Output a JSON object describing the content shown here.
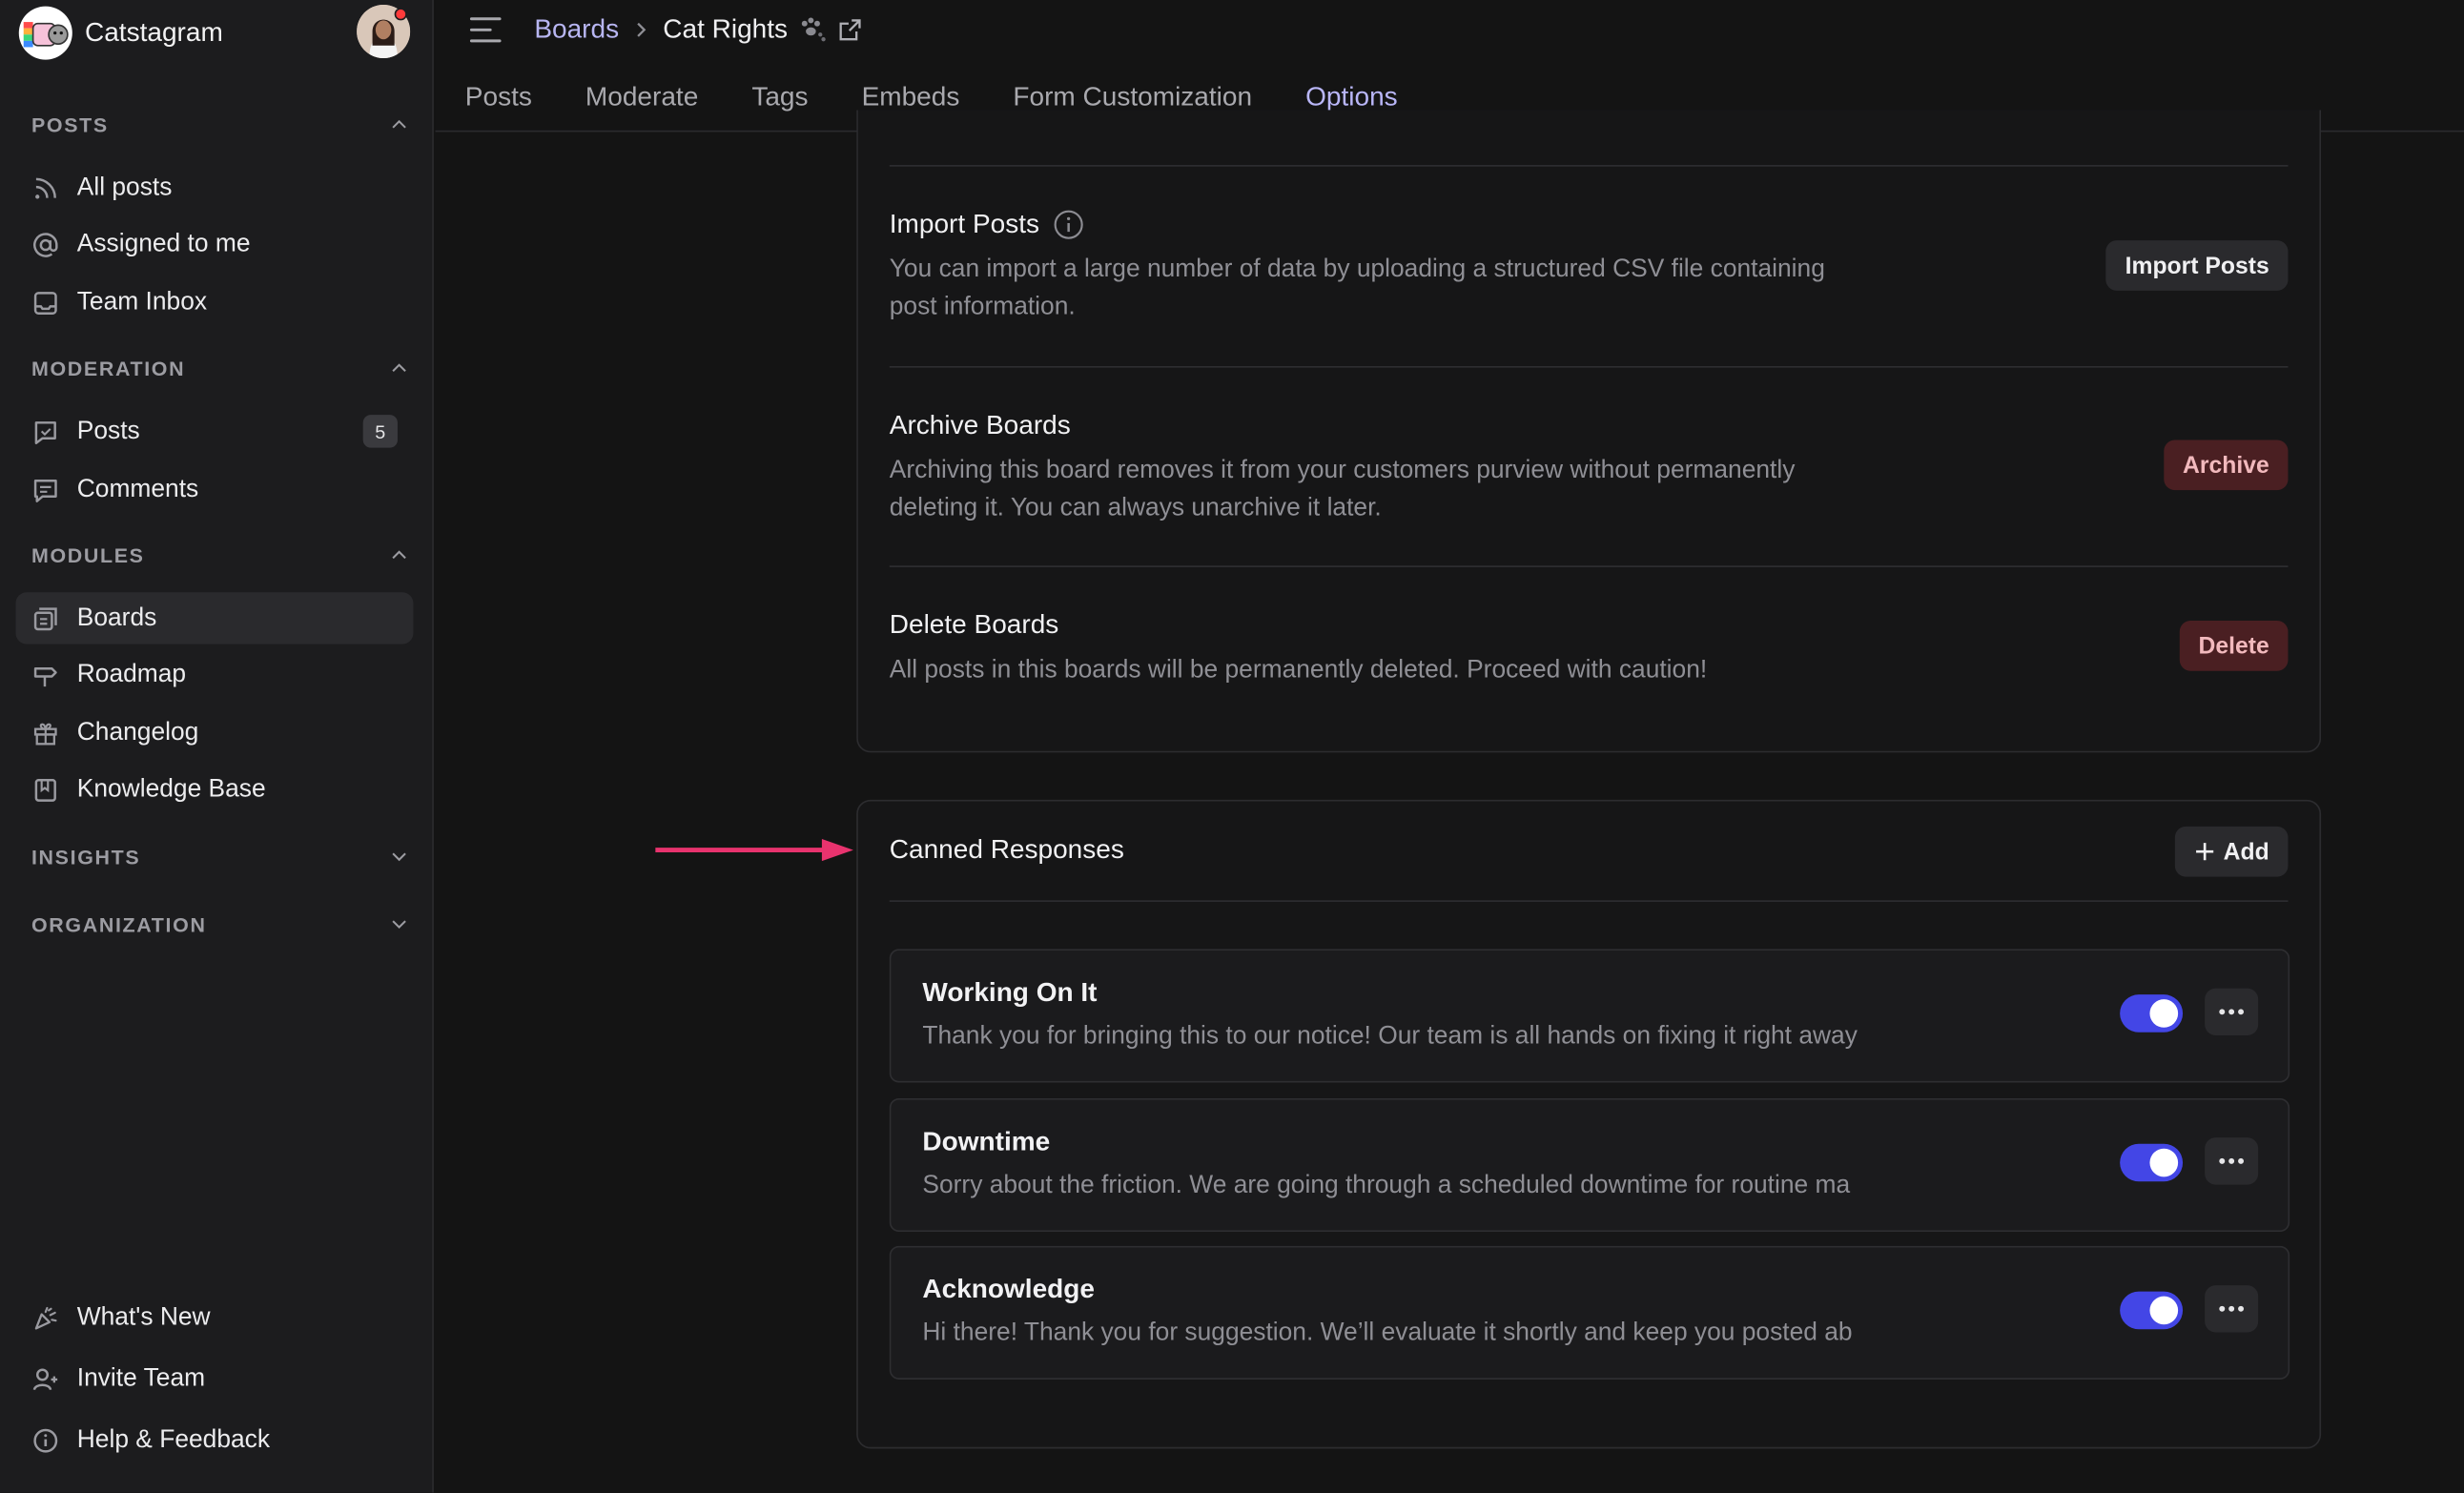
{
  "workspace": {
    "name": "Catstagram"
  },
  "sidebar": {
    "sections": [
      {
        "title": "POSTS",
        "items": [
          {
            "label": "All posts",
            "icon": "rss-icon"
          },
          {
            "label": "Assigned to me",
            "icon": "at-sign-icon"
          },
          {
            "label": "Team Inbox",
            "icon": "inbox-icon"
          }
        ]
      },
      {
        "title": "MODERATION",
        "items": [
          {
            "label": "Posts",
            "icon": "post-moderation-icon",
            "badge": "5"
          },
          {
            "label": "Comments",
            "icon": "comment-icon"
          }
        ]
      },
      {
        "title": "MODULES",
        "items": [
          {
            "label": "Boards",
            "icon": "boards-icon"
          },
          {
            "label": "Roadmap",
            "icon": "signpost-icon"
          },
          {
            "label": "Changelog",
            "icon": "gift-icon"
          },
          {
            "label": "Knowledge Base",
            "icon": "book-icon"
          }
        ]
      },
      {
        "title": "INSIGHTS",
        "items": []
      },
      {
        "title": "ORGANIZATION",
        "items": []
      }
    ],
    "footer": [
      {
        "label": "What's New",
        "icon": "party-popper-icon"
      },
      {
        "label": "Invite Team",
        "icon": "user-plus-icon"
      },
      {
        "label": "Help & Feedback",
        "icon": "info-circle-icon"
      }
    ]
  },
  "breadcrumb": {
    "parent": "Boards",
    "current": "Cat Rights"
  },
  "tabs": [
    "Posts",
    "Moderate",
    "Tags",
    "Embeds",
    "Form Customization",
    "Options"
  ],
  "active_tab": "Options",
  "options": [
    {
      "title": "Import Posts",
      "description": "You can import a large number of data by uploading a structured CSV file containing post information.",
      "button": "Import Posts"
    },
    {
      "title": "Archive Boards",
      "description": "Archiving this board removes it from your customers purview without permanently deleting it. You can always unarchive it later.",
      "button": "Archive"
    },
    {
      "title": "Delete Boards",
      "description": "All posts in this boards will be permanently deleted. Proceed with caution!",
      "button": "Delete"
    }
  ],
  "canned": {
    "title": "Canned Responses",
    "add_label": "Add",
    "responses": [
      {
        "title": "Working On It",
        "text": "Thank you for bringing this to our notice! Our team is all hands on fixing it right away",
        "enabled": true
      },
      {
        "title": "Downtime",
        "text": "Sorry about the friction. We are going through a scheduled downtime for routine ma",
        "enabled": true
      },
      {
        "title": "Acknowledge",
        "text": "Hi there! Thank you for suggestion. We’ll evaluate it shortly and keep you posted ab",
        "enabled": true
      }
    ]
  },
  "colors": {
    "accent": "#4346e6",
    "danger_bg": "#4a1f22",
    "annotation_arrow": "#e8336e"
  }
}
